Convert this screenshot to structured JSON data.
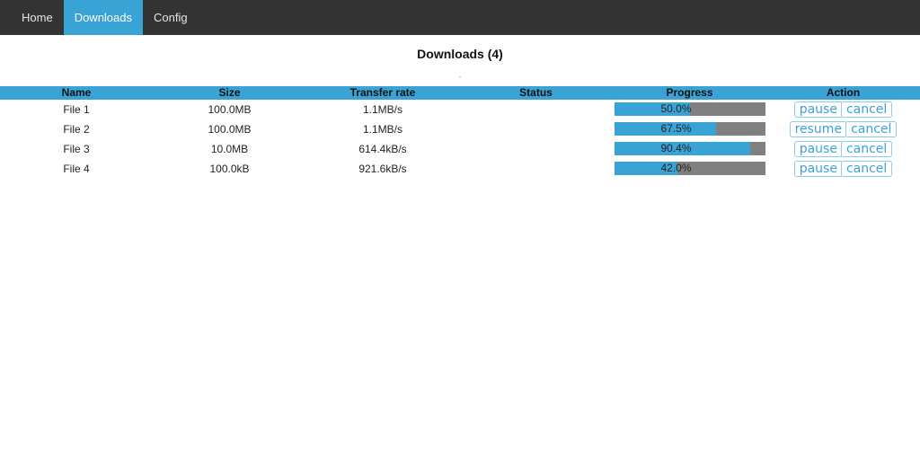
{
  "nav": {
    "items": [
      {
        "label": "Home",
        "active": false
      },
      {
        "label": "Downloads",
        "active": true
      },
      {
        "label": "Config",
        "active": false
      }
    ]
  },
  "page": {
    "title": "Downloads (4)",
    "dot": "."
  },
  "colors": {
    "accent": "#3aa3d6",
    "nav_bg": "#333333",
    "progress_track": "#808080"
  },
  "table": {
    "headers": [
      "Name",
      "Size",
      "Transfer rate",
      "Status",
      "Progress",
      "Action"
    ],
    "rows": [
      {
        "name": "File 1",
        "size": "100.0MB",
        "rate": "1.1MB/s",
        "status": "",
        "progress_label": "50.0%",
        "progress_percent": 50.0,
        "actions": [
          "pause",
          "cancel"
        ]
      },
      {
        "name": "File 2",
        "size": "100.0MB",
        "rate": "1.1MB/s",
        "status": "",
        "progress_label": "67.5%",
        "progress_percent": 67.5,
        "actions": [
          "resume",
          "cancel"
        ]
      },
      {
        "name": "File 3",
        "size": "10.0MB",
        "rate": "614.4kB/s",
        "status": "",
        "progress_label": "90.4%",
        "progress_percent": 90.4,
        "actions": [
          "pause",
          "cancel"
        ]
      },
      {
        "name": "File 4",
        "size": "100.0kB",
        "rate": "921.6kB/s",
        "status": "",
        "progress_label": "42.0%",
        "progress_percent": 42.0,
        "actions": [
          "pause",
          "cancel"
        ]
      }
    ]
  }
}
